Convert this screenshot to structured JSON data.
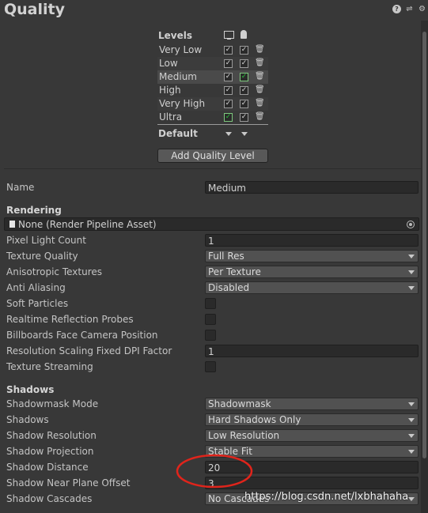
{
  "header": {
    "title": "Quality",
    "icons": [
      "help-icon",
      "preset-icon",
      "gear-icon"
    ]
  },
  "levels": {
    "label": "Levels",
    "platform_icons": [
      "monitor-icon",
      "android-icon"
    ],
    "items": [
      {
        "name": "Very Low",
        "standalone": "check",
        "android": "check"
      },
      {
        "name": "Low",
        "standalone": "check",
        "android": "check"
      },
      {
        "name": "Medium",
        "standalone": "check",
        "android": "check-default",
        "selected": true
      },
      {
        "name": "High",
        "standalone": "check",
        "android": "check"
      },
      {
        "name": "Very High",
        "standalone": "check",
        "android": "check"
      },
      {
        "name": "Ultra",
        "standalone": "check-default",
        "android": "check"
      }
    ],
    "default_label": "Default",
    "add_button": "Add Quality Level"
  },
  "name": {
    "label": "Name",
    "value": "Medium"
  },
  "rendering": {
    "header": "Rendering",
    "pipeline_asset": "None (Render Pipeline Asset)",
    "pixel_light_count": {
      "label": "Pixel Light Count",
      "value": "1"
    },
    "texture_quality": {
      "label": "Texture Quality",
      "value": "Full Res"
    },
    "anisotropic": {
      "label": "Anisotropic Textures",
      "value": "Per Texture"
    },
    "anti_aliasing": {
      "label": "Anti Aliasing",
      "value": "Disabled"
    },
    "soft_particles": {
      "label": "Soft Particles"
    },
    "realtime_reflection": {
      "label": "Realtime Reflection Probes"
    },
    "billboards": {
      "label": "Billboards Face Camera Position"
    },
    "res_scaling": {
      "label": "Resolution Scaling Fixed DPI Factor",
      "value": "1"
    },
    "texture_streaming": {
      "label": "Texture Streaming"
    }
  },
  "shadows": {
    "header": "Shadows",
    "mask_mode": {
      "label": "Shadowmask Mode",
      "value": "Shadowmask"
    },
    "shadows": {
      "label": "Shadows",
      "value": "Hard Shadows Only"
    },
    "resolution": {
      "label": "Shadow Resolution",
      "value": "Low Resolution"
    },
    "projection": {
      "label": "Shadow Projection",
      "value": "Stable Fit"
    },
    "distance": {
      "label": "Shadow Distance",
      "value": "20"
    },
    "near_plane": {
      "label": "Shadow Near Plane Offset",
      "value": "3"
    },
    "cascades": {
      "label": "Shadow Cascades",
      "value": "No Cascades"
    }
  },
  "watermark": "https://blog.csdn.net/lxbhahaha",
  "colors": {
    "background": "#383838",
    "highlight_circle": "#e0241b",
    "default_check": "#27c33a"
  }
}
